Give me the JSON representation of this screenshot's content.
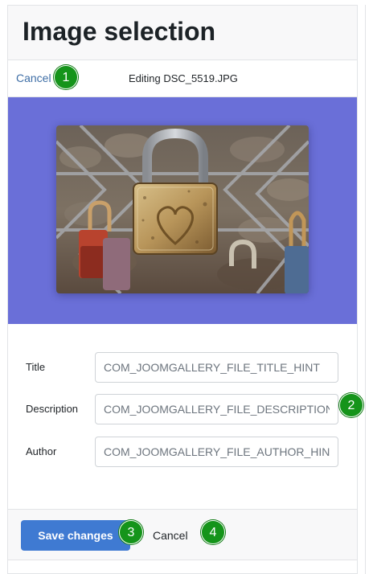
{
  "header": {
    "title": "Image selection"
  },
  "toolbar": {
    "cancel_label": "Cancel",
    "editing_text": "Editing DSC_5519.JPG"
  },
  "preview": {
    "background_color": "#6a6fd8",
    "image_subject": "padlock-photo"
  },
  "form": {
    "fields": [
      {
        "label": "Title",
        "value": "COM_JOOMGALLERY_FILE_TITLE_HINT"
      },
      {
        "label": "Description",
        "value": "COM_JOOMGALLERY_FILE_DESCRIPTION_"
      },
      {
        "label": "Author",
        "value": "COM_JOOMGALLERY_FILE_AUTHOR_HINT"
      }
    ]
  },
  "footer": {
    "save_label": "Save changes",
    "cancel_label": "Cancel"
  },
  "badges": [
    "1",
    "2",
    "3",
    "4"
  ],
  "colors": {
    "accent": "#3f7ad2",
    "link": "#3e6ea6",
    "badge": "#15941a"
  }
}
